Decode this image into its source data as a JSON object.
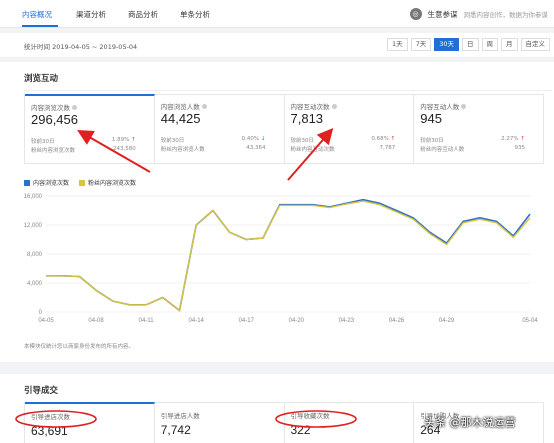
{
  "nav": {
    "tabs": [
      "内容概况",
      "渠道分析",
      "商品分析",
      "单条分析"
    ],
    "active_tab": "内容概况",
    "right_label": "生意参谋",
    "right_hint": "洞悉内容创作，数据为你参谋"
  },
  "date_row": {
    "stat_text": "统计时间 2019-04-05 ~ 2019-05-04",
    "range_buttons": [
      "1天",
      "7天",
      "30天",
      "日",
      "周",
      "月",
      "自定义"
    ],
    "active_range": "30天"
  },
  "browse": {
    "section_title": "浏览互动",
    "cards": [
      {
        "title": "内容浏览次数",
        "value": "296,456",
        "sub1": "较前30日",
        "pct": "1.89%",
        "trend": "up",
        "sub2": "粉丝内容浏览次数",
        "num2": "243,580"
      },
      {
        "title": "内容浏览人数",
        "value": "44,425",
        "sub1": "较前30日",
        "pct": "0.40%",
        "trend": "down",
        "sub2": "粉丝内容浏览人数",
        "num2": "43,364"
      },
      {
        "title": "内容互动次数",
        "value": "7,813",
        "sub1": "较前30日",
        "pct": "0.68%",
        "trend": "up",
        "sub2": "粉丝内容互动次数",
        "num2": "7,787"
      },
      {
        "title": "内容互动人数",
        "value": "945",
        "sub1": "较前30日",
        "pct": "2.27%",
        "trend": "up",
        "sub2": "粉丝内容互动人数",
        "num2": "935"
      }
    ],
    "note": "本模块仅统计您以商家身份发布的所有内容。"
  },
  "guide": {
    "section_title": "引导成交",
    "cards": [
      {
        "title": "引导进店次数",
        "value": "63,691"
      },
      {
        "title": "引导进店人数",
        "value": "7,742"
      },
      {
        "title": "引导收藏次数",
        "value": "322"
      },
      {
        "title": "引导加购人数",
        "value": "264"
      }
    ]
  },
  "watermark": "头条 @那木说运营",
  "colors": {
    "accent": "#1f6fd6",
    "series1": "#2e6fd2",
    "series2": "#d9c43a",
    "annotation": "#e02020"
  },
  "chart_data": {
    "type": "line",
    "x": [
      "04-05",
      "04-06",
      "04-07",
      "04-08",
      "04-09",
      "04-10",
      "04-11",
      "04-12",
      "04-13",
      "04-14",
      "04-15",
      "04-16",
      "04-17",
      "04-18",
      "04-19",
      "04-20",
      "04-21",
      "04-22",
      "04-23",
      "04-24",
      "04-25",
      "04-26",
      "04-27",
      "04-28",
      "04-29",
      "04-30",
      "05-01",
      "05-02",
      "05-03",
      "05-04"
    ],
    "xticks": [
      "04-05",
      "04-08",
      "04-11",
      "04-14",
      "04-17",
      "04-20",
      "04-23",
      "04-26",
      "04-29",
      "05-04"
    ],
    "ylim": [
      0,
      16000
    ],
    "yticks": [
      "0",
      "4,000",
      "8,000",
      "12,000",
      "16,000"
    ],
    "series": [
      {
        "name": "内容浏览次数",
        "values": [
          5000,
          5000,
          4900,
          3000,
          1500,
          1000,
          1000,
          2000,
          200,
          12000,
          14000,
          11000,
          10000,
          10200,
          14800,
          14800,
          14800,
          14500,
          15000,
          15500,
          15000,
          14000,
          13000,
          11000,
          9500,
          12500,
          13000,
          12500,
          10500,
          13500
        ]
      },
      {
        "name": "粉丝内容浏览次数",
        "values": [
          5000,
          5000,
          4900,
          3000,
          1500,
          1000,
          1000,
          2000,
          200,
          12000,
          14000,
          11000,
          10000,
          10200,
          14700,
          14700,
          14700,
          14400,
          14900,
          15300,
          14800,
          13800,
          12800,
          10800,
          9300,
          12300,
          12800,
          12300,
          10300,
          13000
        ]
      }
    ]
  }
}
